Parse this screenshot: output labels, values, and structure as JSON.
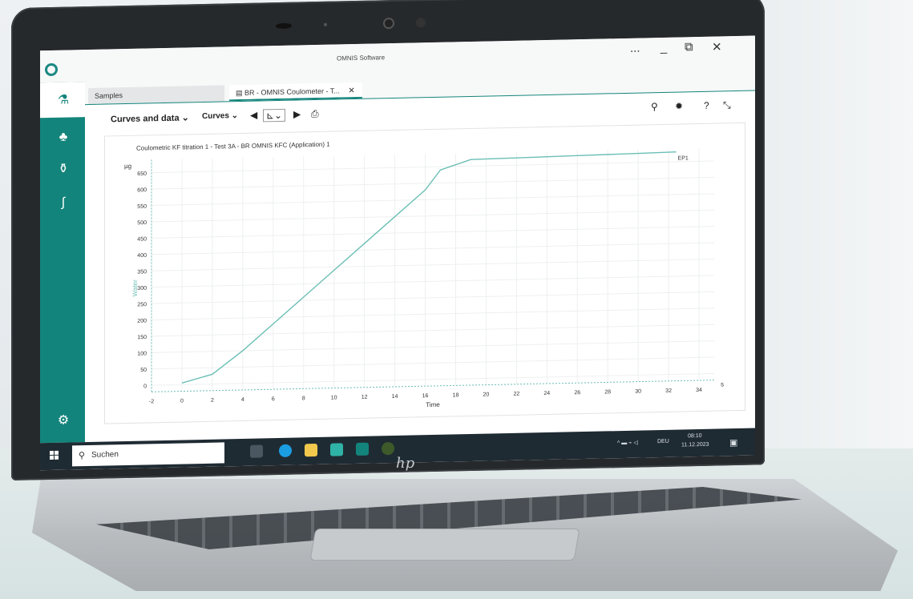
{
  "window": {
    "title": "OMNIS Software",
    "controls": [
      "...",
      "_",
      "⧉",
      "✕"
    ]
  },
  "tabs": [
    {
      "label": "Samples",
      "active": false
    },
    {
      "label": "BR - OMNIS Coulometer - T...",
      "active": true
    }
  ],
  "toolbar": {
    "curves_and_data": "Curves and data",
    "curves": "Curves",
    "help": "?"
  },
  "sidebar": {
    "icons": [
      "samples-icon",
      "hierarchy-icon",
      "sample-vials-icon",
      "formula-icon",
      "settings-icon"
    ]
  },
  "chart_data": {
    "type": "line",
    "title": "Coulometric KF titration 1 - Test 3A - BR OMNIS KFC (Application)  1",
    "xlabel": "Time",
    "ylabel": "Water",
    "y_unit": "µg",
    "x_unit": "s",
    "xlim": [
      -2,
      35
    ],
    "ylim": [
      -20,
      690
    ],
    "x_ticks": [
      "-2",
      "0",
      "2",
      "4",
      "6",
      "8",
      "10",
      "12",
      "14",
      "16",
      "18",
      "20",
      "22",
      "24",
      "26",
      "28",
      "30",
      "32",
      "34"
    ],
    "y_ticks": [
      "0",
      "50",
      "100",
      "150",
      "200",
      "250",
      "300",
      "350",
      "400",
      "450",
      "500",
      "550",
      "600",
      "650"
    ],
    "series": [
      {
        "x": [
          0,
          2,
          4,
          6,
          8,
          10,
          12,
          14,
          16,
          17,
          19,
          22,
          26,
          30,
          32.5
        ],
        "y": [
          5,
          30,
          100,
          180,
          260,
          340,
          420,
          500,
          580,
          640,
          670,
          672,
          675,
          678,
          680
        ]
      }
    ],
    "annotation": "EP1",
    "grid": true,
    "line_color": "#6bbfb5"
  },
  "taskbar": {
    "search_placeholder": "Suchen",
    "language": "DEU",
    "time": "08:10",
    "date": "11.12.2023"
  },
  "branding": {
    "accent": "#13847b",
    "laptop_logo": "hp"
  }
}
